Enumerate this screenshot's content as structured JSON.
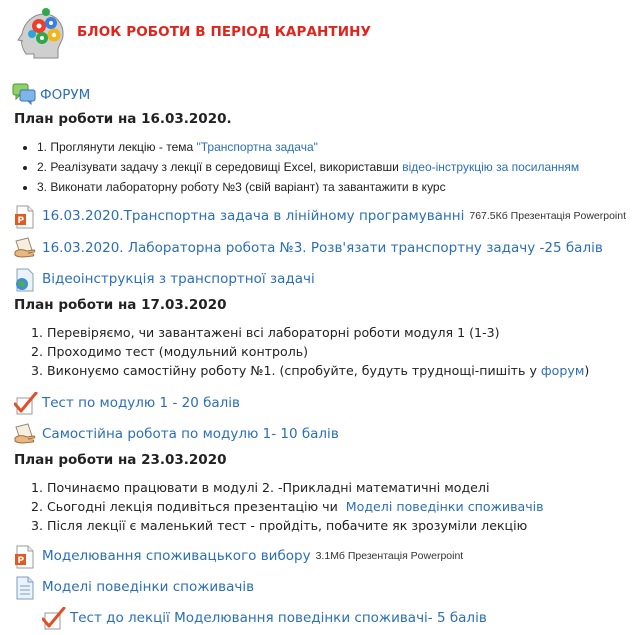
{
  "header": {
    "title": "БЛОК РОБОТИ В ПЕРІОД КАРАНТИНУ"
  },
  "forum": {
    "label": "ФОРУМ"
  },
  "plan1": {
    "heading": "План роботи на 16.03.2020.",
    "items": [
      {
        "text": "1. Проглянути лекцію - тема ",
        "link": "\"Транспортна задача\""
      },
      {
        "text": "2. Реалізувати задачу з лекції в середовищі Excel, використавши ",
        "link": "відео-інструкцію за посиланням"
      },
      {
        "text": "3. Виконати лабораторну роботу №3 (свій варіант) та завантажити в курс"
      }
    ]
  },
  "act1": {
    "label": "16.03.2020.Транспортна задача в лінійному програмуванні",
    "meta": "767.5Кб Презентація Powerpoint"
  },
  "act2": {
    "label": "16.03.2020. Лабораторна робота №3. Розв'язати транспортну задачу -25 балів"
  },
  "act3": {
    "label": "Відеоінструкція з транспортної задачі"
  },
  "plan2": {
    "heading": "План роботи на 17.03.2020",
    "items": [
      {
        "text": "Перевіряємо, чи завантажені всі лабораторні роботи модуля 1 (1-3)"
      },
      {
        "text": "Проходимо тест (модульний контроль)"
      },
      {
        "text": "Виконуємо самостійну роботу №1. (спробуйте, будуть труднощі-пишіть у ",
        "link": "форум",
        "after": ")"
      }
    ]
  },
  "act4": {
    "label": "Тест по модулю 1 - 20 балів"
  },
  "act5": {
    "label": "Самостійна робота по модулю 1- 10 балів"
  },
  "plan3": {
    "heading": "План роботи на 23.03.2020",
    "items": [
      {
        "text": "Починаємо працювати в модулі 2. -Прикладні математичні моделі"
      },
      {
        "text": "Сьогодні лекція подивіться презентацію чи  ",
        "link": "Моделі поведінки споживачів"
      },
      {
        "text": "Після лекції є маленький тест - пройдіть, побачите як зрозуміли лекцію"
      }
    ]
  },
  "act6": {
    "label": "Моделювання споживацького вибору",
    "meta": "3.1Мб Презентація Powerpoint"
  },
  "act7": {
    "label": "Моделі поведінки споживачів"
  },
  "act8": {
    "label": "Тест до лекції Моделювання поведінки споживачі- 5 балів"
  },
  "icons": {
    "logo": "head-gears-icon",
    "forum": "forum-icon",
    "powerpoint": "powerpoint-file-icon",
    "assignment": "assignment-hand-icon",
    "url": "globe-url-icon",
    "quiz": "quiz-check-icon",
    "page": "page-document-icon"
  },
  "colors": {
    "title": "#e0241b",
    "link": "#2a6fb8"
  }
}
